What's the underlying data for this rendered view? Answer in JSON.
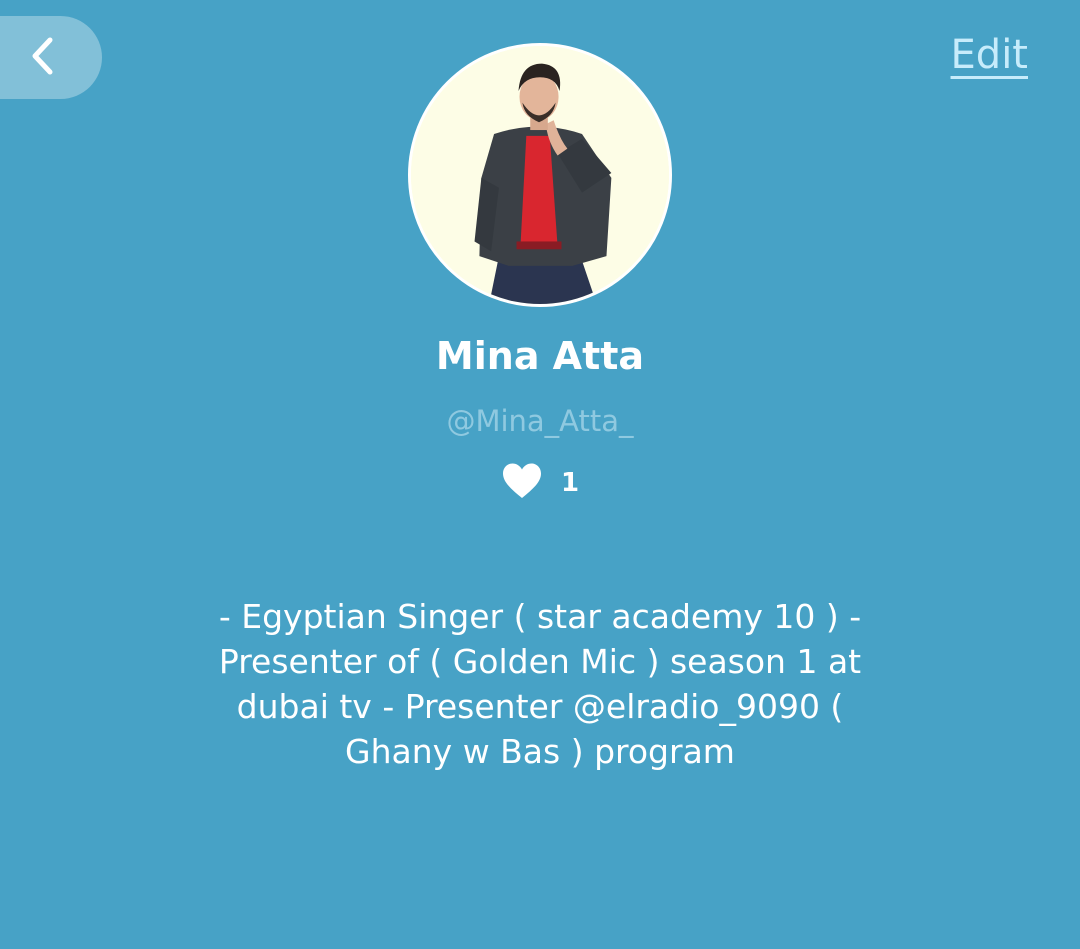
{
  "header": {
    "back_icon": "chevron-left-icon",
    "edit_label": "Edit"
  },
  "profile": {
    "name": "Mina Atta",
    "handle": "@Mina_Atta_",
    "likes_icon": "heart-icon",
    "likes_count": "1",
    "bio": "- Egyptian Singer ( star academy 10 ) - Presenter of ( Golden Mic ) season 1 at dubai tv - Presenter @elradio_9090 ( Ghany w Bas ) program"
  },
  "colors": {
    "background": "#47a2c6",
    "edit_link": "#c7ecfb",
    "handle": "#8fc9e0",
    "avatar_bg": "#fdfde6"
  }
}
